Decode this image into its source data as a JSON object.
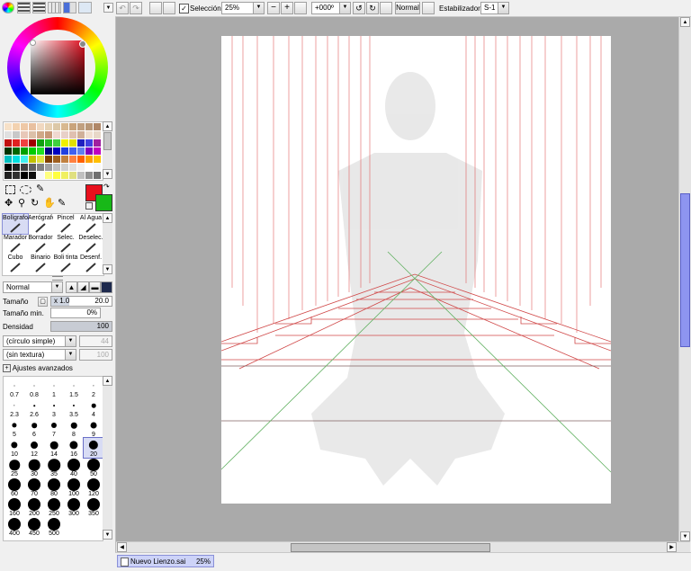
{
  "toolbar": {
    "selection_label": "Selección",
    "selection_checked": true,
    "zoom": "25%",
    "rotation": "+000º",
    "blend_mode": "Normal",
    "stabilizer_label": "Estabilizador",
    "stabilizer_value": "S-1"
  },
  "tools": [
    {
      "label": "Bolígrafo",
      "icon": "pen-icon"
    },
    {
      "label": "Aerógrafo",
      "icon": "airbrush-icon"
    },
    {
      "label": "Pincel",
      "icon": "brush-icon"
    },
    {
      "label": "Al Agua",
      "icon": "watercolor-icon"
    },
    {
      "label": "Marador",
      "icon": "marker-icon"
    },
    {
      "label": "Borrador",
      "icon": "eraser-icon"
    },
    {
      "label": "Selec.",
      "icon": "select-pen-icon"
    },
    {
      "label": "Deselec.",
      "icon": "deselect-pen-icon"
    },
    {
      "label": "Cubo",
      "icon": "bucket-icon"
    },
    {
      "label": "Binario",
      "icon": "binary-pen-icon"
    },
    {
      "label": "Boli tinta",
      "icon": "ink-pen-icon"
    },
    {
      "label": "Desenf.",
      "icon": "blur-icon"
    }
  ],
  "brush_settings": {
    "blend_mode": "Normal",
    "size_label": "Tamaño",
    "size_multiplier": "x 1.0",
    "size_value": "20.0",
    "min_size_label": "Tamaño min.",
    "min_size_value": "0%",
    "density_label": "Densidad",
    "density_value": "100",
    "shape": "(círculo simple)",
    "shape_value": "44",
    "texture": "(sin textura)",
    "texture_value": "100",
    "advanced_label": "Ajustes avanzados"
  },
  "brush_sizes": [
    "0.7",
    "0.8",
    "1",
    "1.5",
    "2",
    "2.3",
    "2.6",
    "3",
    "3.5",
    "4",
    "5",
    "6",
    "7",
    "8",
    "9",
    "10",
    "12",
    "14",
    "16",
    "20",
    "25",
    "30",
    "35",
    "40",
    "50",
    "60",
    "70",
    "80",
    "100",
    "120",
    "160",
    "200",
    "250",
    "300",
    "350",
    "400",
    "450",
    "500"
  ],
  "selected_brush_size": "20",
  "colors": {
    "primary": "#e8101c",
    "secondary": "#18b818"
  },
  "palette": [
    "#f7e1c8",
    "#f3d2b0",
    "#eec8a6",
    "#e8c0a0",
    "#f0d8c0",
    "#e6d2b4",
    "#dcc8a8",
    "#d8b890",
    "#c9a47c",
    "#c0a080",
    "#b89878",
    "#b08868",
    "#e0e0e0",
    "#c8c8c8",
    "#e8c8b8",
    "#dcc0a8",
    "#d0a888",
    "#c89878",
    "#f0d8d0",
    "#e8d0c8",
    "#e0c0b0",
    "#d0b098",
    "#f0e0d0",
    "#e8d8c8",
    "#c01010",
    "#e02020",
    "#f04040",
    "#a00000",
    "#10a010",
    "#20c020",
    "#40d040",
    "#f0f000",
    "#e0e000",
    "#2020c0",
    "#4040e0",
    "#a020a0",
    "#003300",
    "#006600",
    "#00a000",
    "#00cc00",
    "#20e020",
    "#000080",
    "#0000c0",
    "#2040e0",
    "#4060f0",
    "#6080f0",
    "#8000c0",
    "#c000c0",
    "#00c0c0",
    "#00e0e0",
    "#40f0f0",
    "#c0c000",
    "#e0e040",
    "#804000",
    "#a06020",
    "#c08040",
    "#ff8040",
    "#ff6000",
    "#ffa000",
    "#ffc000",
    "#000000",
    "#202020",
    "#404040",
    "#606060",
    "#808080",
    "#a0a0a0",
    "#c0c0c0",
    "#d0d0d0",
    "#e0e0e0",
    "#f0f0f0",
    "#ffffff",
    "#f8f8f8",
    "#202020",
    "#303030",
    "#000000",
    "#101010",
    "#f8f8f8",
    "#ffff80",
    "#ffff40",
    "#f0f060",
    "#e0e080",
    "#c0c0c0",
    "#909090",
    "#707070"
  ],
  "statusbar": {
    "tab_name": "Nuevo Lienzo.sai",
    "tab_zoom": "25%"
  }
}
